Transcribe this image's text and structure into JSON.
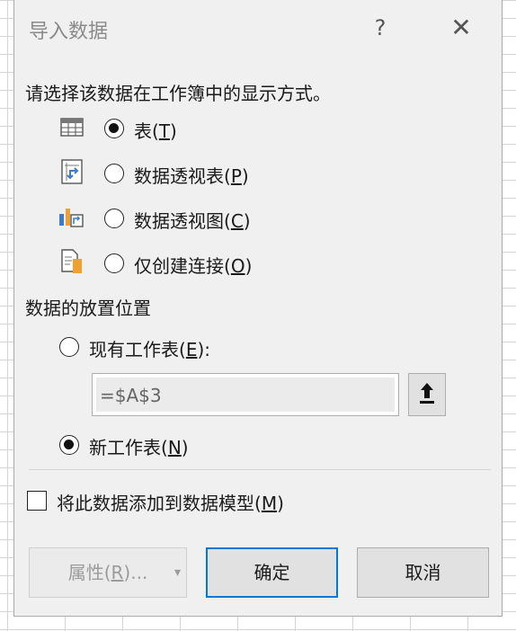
{
  "dialog": {
    "title": "导入数据",
    "help_glyph": "?",
    "close_glyph": "✕"
  },
  "display": {
    "prompt": "请选择该数据在工作簿中的显示方式。",
    "options": [
      {
        "label_pre": "表(",
        "key": "T",
        "label_post": ")",
        "icon": "table-icon",
        "selected": true
      },
      {
        "label_pre": "数据透视表(",
        "key": "P",
        "label_post": ")",
        "icon": "pivot-table-icon",
        "selected": false
      },
      {
        "label_pre": "数据透视图(",
        "key": "C",
        "label_post": ")",
        "icon": "pivot-chart-icon",
        "selected": false
      },
      {
        "label_pre": "仅创建连接(",
        "key": "O",
        "label_post": ")",
        "icon": "connection-only-icon",
        "selected": false
      }
    ]
  },
  "placement": {
    "heading": "数据的放置位置",
    "existing": {
      "label_pre": "现有工作表(",
      "key": "E",
      "label_post": "):",
      "selected": false
    },
    "range_value": "=$A$3",
    "new_sheet": {
      "label_pre": "新工作表(",
      "key": "N",
      "label_post": ")",
      "selected": true
    }
  },
  "data_model": {
    "label_pre": "将此数据添加到数据模型(",
    "key": "M",
    "label_post": ")",
    "checked": false
  },
  "buttons": {
    "properties": {
      "label_pre": "属性(",
      "key": "R",
      "label_post": ")..."
    },
    "properties_arrow": "▾",
    "ok": "确定",
    "cancel": "取消"
  },
  "colors": {
    "accent": "#0078d7",
    "icon_blue": "#3d7cc9",
    "icon_orange": "#f0a030"
  }
}
